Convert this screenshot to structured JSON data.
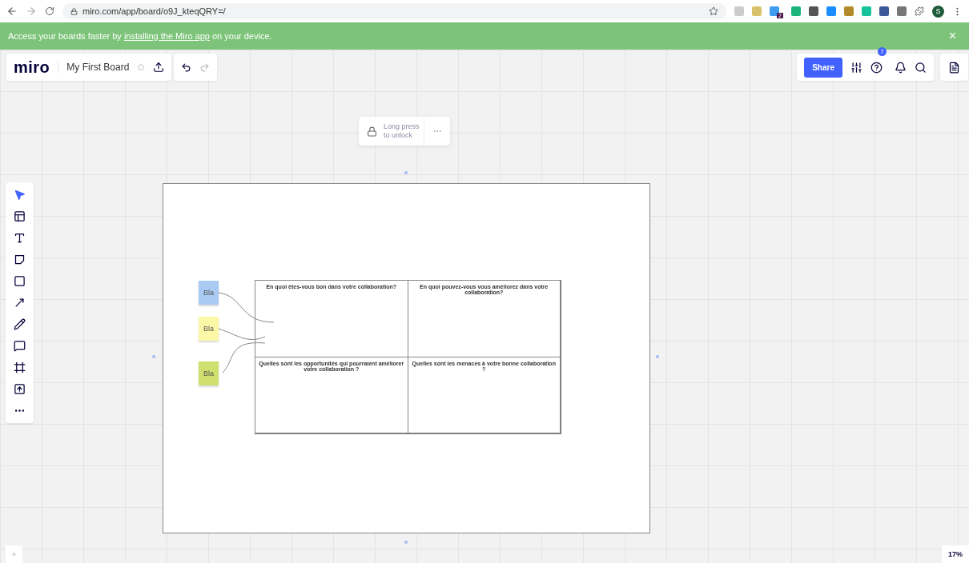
{
  "browser": {
    "url": "miro.com/app/board/o9J_kteqQRY=/",
    "extension_badge": "2",
    "profile_initial": "S"
  },
  "banner": {
    "text_before": "Access your boards faster by ",
    "link": "installing the Miro app",
    "text_after": " on your device.",
    "close": "×"
  },
  "board_header": {
    "logo": "miro",
    "title": "My First Board"
  },
  "top_right": {
    "share": "Share",
    "help_badge": "7"
  },
  "tools": [
    {
      "kind": "select",
      "selected": true
    },
    {
      "kind": "templates",
      "selected": false
    },
    {
      "kind": "text",
      "selected": false
    },
    {
      "kind": "sticky",
      "selected": false
    },
    {
      "kind": "shape",
      "selected": false
    },
    {
      "kind": "arrow",
      "selected": false
    },
    {
      "kind": "pen",
      "selected": false
    },
    {
      "kind": "comment",
      "selected": false
    },
    {
      "kind": "frame",
      "selected": false
    },
    {
      "kind": "upload",
      "selected": false
    },
    {
      "kind": "more",
      "selected": false
    }
  ],
  "lock_popup": {
    "text": "Long press to unlock"
  },
  "frame": {
    "cells": [
      "En quoi êtes-vous bon dans votre collaboration?",
      "En quoi pouvez-vous vous améliorez dans votre collaboration?",
      "Quelles sont les opportunités qui pourraient améliorer votre collaboration ?",
      "Quelles sont les menaces à votre bonne collaboration ?"
    ],
    "stickies": [
      {
        "text": "Bla",
        "color": "#a9cbf3"
      },
      {
        "text": "Bla",
        "color": "#fdf8a6"
      },
      {
        "text": "Bla",
        "color": "#cfe06e"
      }
    ]
  },
  "sidebar_toggle": "»",
  "zoom": "17%"
}
